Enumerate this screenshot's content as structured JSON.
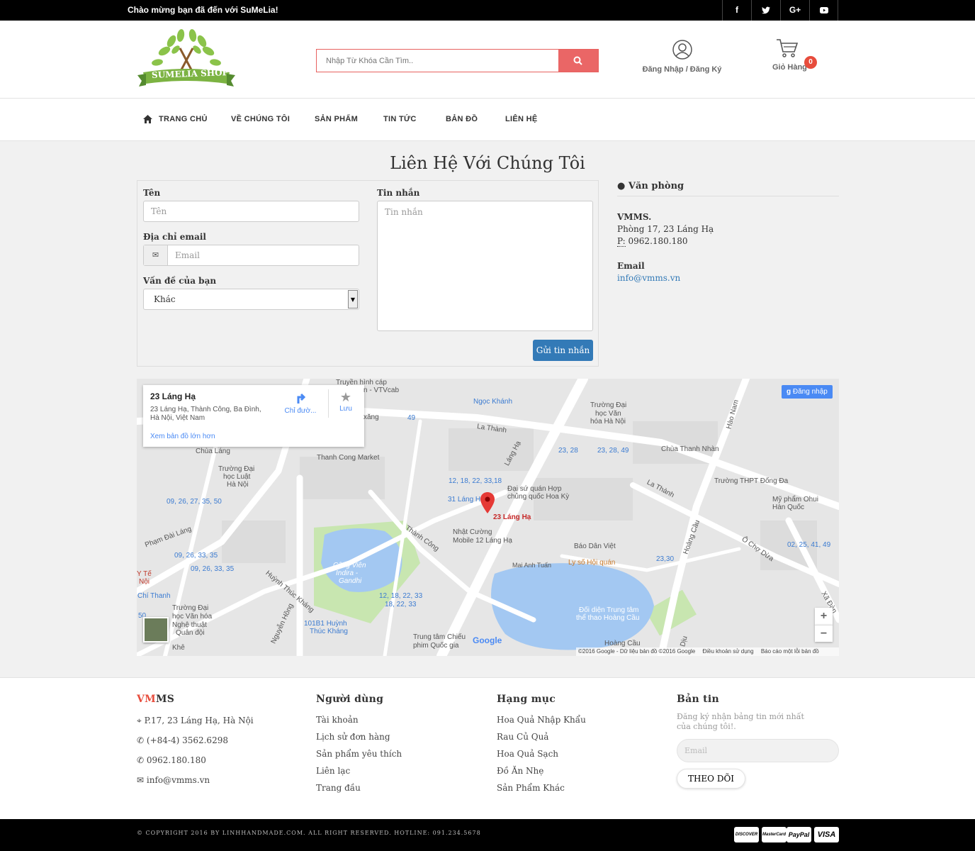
{
  "topbar": {
    "welcome": "Chào mừng bạn đã đến với SuMeLia!",
    "social": [
      "f",
      "t",
      "G+",
      "▶"
    ]
  },
  "header": {
    "logo_text": "SUMELIA SHOP",
    "search_placeholder": "Nhập Từ Khóa Cần Tìm..",
    "account_label": "Đăng Nhập / Đăng Ký",
    "cart_label": "Giỏ Hàng",
    "cart_count": "0"
  },
  "nav": {
    "items": [
      "TRANG CHỦ",
      "VỀ CHÚNG TÔI",
      "SẢN PHẨM",
      "TIN TỨC",
      "BẢN ĐỒ",
      "LIÊN HỆ"
    ]
  },
  "page": {
    "title": "Liên Hệ Với Chúng Tôi"
  },
  "form": {
    "name_label": "Tên",
    "name_placeholder": "Tên",
    "email_label": "Địa chỉ email",
    "email_placeholder": "Email",
    "issue_label": "Vấn đề của bạn",
    "issue_value": "Khác",
    "message_label": "Tin nhắn",
    "message_placeholder": "Tin nhắn",
    "submit": "Gửi tin nhắn"
  },
  "office": {
    "heading": "Văn phòng",
    "company": "VMMS.",
    "address": "Phòng 17, 23 Láng Hạ",
    "phone_prefix": "P:",
    "phone": "0962.180.180",
    "email_label": "Email",
    "email": "info@vmms.vn"
  },
  "map": {
    "info_title": "23 Láng Hạ",
    "info_address1": "23 Láng Hạ, Thành Công, Ba Đình,",
    "info_address2": "Hà Nội, Việt Nam",
    "info_directions": "Chỉ đườ...",
    "info_save": "Lưu",
    "info_larger": "Xem bản đồ lớn hơn",
    "signin": "Đăng nhập",
    "marker_label": "23 Láng Hạ",
    "labels": [
      "Truyền hình cáp",
      "n - VTVcab",
      "Ngọc Khánh",
      "Trường Đại",
      "học Văn",
      "hóa Hà Nội",
      "La Thành",
      "Chùa Thanh Nhàn",
      "Thanh Cong Market",
      "Trường Đại",
      "học Luật",
      "Hà Nội",
      "Đại sứ quán Hợp",
      "chủng quốc Hoa Kỳ",
      "Trường THPT Đống Đa",
      "Mỹ phẩm Ohui",
      "Hàn Quốc",
      "Nhật Cường",
      "Mobile 12 Láng Hạ",
      "Báo Dân Việt",
      "Ly số Hội quán",
      "Công Viên",
      "Indira -",
      "Gandhi",
      "Trường Đại",
      "học Văn hóa",
      "Nghệ thuật",
      "Quân đội",
      "Trung tâm Chiếu",
      "phim Quốc gia",
      "Đối diện Trung tâm",
      "thể thao Hoàng Cầu",
      "Chùa Láng",
      "Mai Anh Tuấn",
      "xăng",
      "Láng Hạ",
      "Thành Công",
      "La Thành",
      "Hoàng Cầu",
      "Hào Nam",
      "Ô Chợ Dừa",
      "Huỳnh Thúc Kháng",
      "Nguyễn Hồng",
      "Phạm Đài Láng",
      "Xã Đàn",
      "Y Tế",
      "Nội",
      "Chí Thanh",
      "Khê",
      "Hoàng Cầu",
      "Dịu"
    ],
    "bus": [
      "49",
      "23, 28",
      "23, 28, 49",
      "12, 18, 22, 33,18",
      "31 Láng Hạ",
      "09, 26, 27, 35, 50",
      "09, 26, 33, 35",
      "09, 26, 33, 35",
      "02, 25, 41, 49",
      "23,30",
      "12, 18, 22, 33",
      "18, 22, 33",
      "101B1 Huỳnh",
      "Thúc Kháng",
      "50"
    ],
    "zoom_in": "+",
    "zoom_out": "−",
    "google": "Google",
    "attribution": "©2016 Google - Dữ liệu bản đồ ©2016 Google",
    "terms": "Điều khoản sử dụng",
    "report": "Báo cáo một lỗi bản đồ"
  },
  "footer": {
    "brand_red": "VM",
    "brand_rest": "MS",
    "address": "P.17, 23 Láng Hạ, Hà Nội",
    "phone1": "(+84-4) 3562.6298",
    "phone2": "0962.180.180",
    "email": "info@vmms.vn",
    "users_title": "Người dùng",
    "users_links": [
      "Tài khoản",
      "Lịch sử đơn hàng",
      "Sản phẩm yêu thích",
      "Liên lạc",
      "Trang đầu"
    ],
    "cat_title": "Hạng mục",
    "cat_links": [
      "Hoa Quả Nhập Khẩu",
      "Rau Củ Quả",
      "Hoa Quả Sạch",
      "Đồ Ăn Nhẹ",
      "Sản Phẩm Khác"
    ],
    "news_title": "Bản tin",
    "news_text": "Đăng ký nhận bảng tin mới nhất của chúng tôi!.",
    "news_placeholder": "Email",
    "news_button": "THEO DÕI",
    "copyright": "© COPYRIGHT 2016 BY LINHHANDMADE.COM. ALL RIGHT RESERVED. HOTLINE: 091.234.5678",
    "payments": [
      "DISCOVER",
      "MasterCard",
      "PayPal",
      "VISA"
    ]
  }
}
